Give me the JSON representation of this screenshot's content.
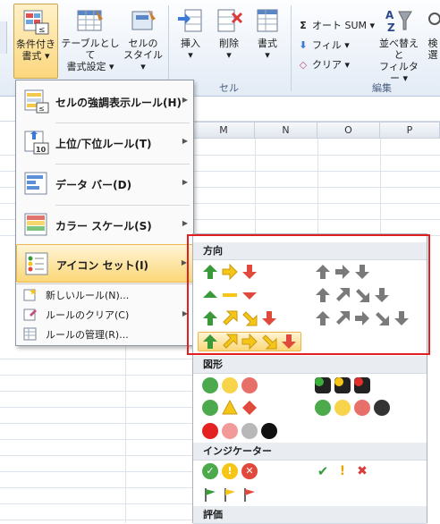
{
  "ribbon": {
    "conditional_format": {
      "line1": "条件付き",
      "line2": "書式 ▾"
    },
    "format_as_table": {
      "line1": "テーブルとして",
      "line2": "書式設定 ▾"
    },
    "cell_styles": {
      "line1": "セルの",
      "line2": "スタイル ▾"
    },
    "insert": {
      "line1": "挿入",
      "line2": "▾"
    },
    "delete": {
      "line1": "削除",
      "line2": "▾"
    },
    "format": {
      "line1": "書式",
      "line2": "▾"
    },
    "cells_group": "セル",
    "editing_group": "編集",
    "autosum": "オート SUM ▾",
    "fill": "フィル ▾",
    "clear": "クリア ▾",
    "sort_filter": {
      "line1": "並べ替えと",
      "line2": "フィルター ▾"
    },
    "find_select": {
      "line1": "検",
      "line2": "選"
    }
  },
  "columns": [
    "M",
    "N",
    "O",
    "P"
  ],
  "menu": {
    "items": [
      {
        "label": "セルの強調表示ルール(H)"
      },
      {
        "label": "上位/下位ルール(T)"
      },
      {
        "label": "データ バー(D)"
      },
      {
        "label": "カラー スケール(S)"
      },
      {
        "label": "アイコン セット(I)"
      }
    ],
    "small_items": [
      {
        "label": "新しいルール(N)..."
      },
      {
        "label": "ルールのクリア(C)"
      },
      {
        "label": "ルールの管理(R)..."
      }
    ]
  },
  "iconsets": {
    "sections": {
      "direction": "方向",
      "shapes": "図形",
      "indicators": "インジケーター",
      "ratings": "評価"
    }
  },
  "colors": {
    "green": "#3a9a3a",
    "yellow": "#f5c518",
    "red": "#e04a3c",
    "gray": "#7a7a7a",
    "highlight_border": "#e02020"
  }
}
